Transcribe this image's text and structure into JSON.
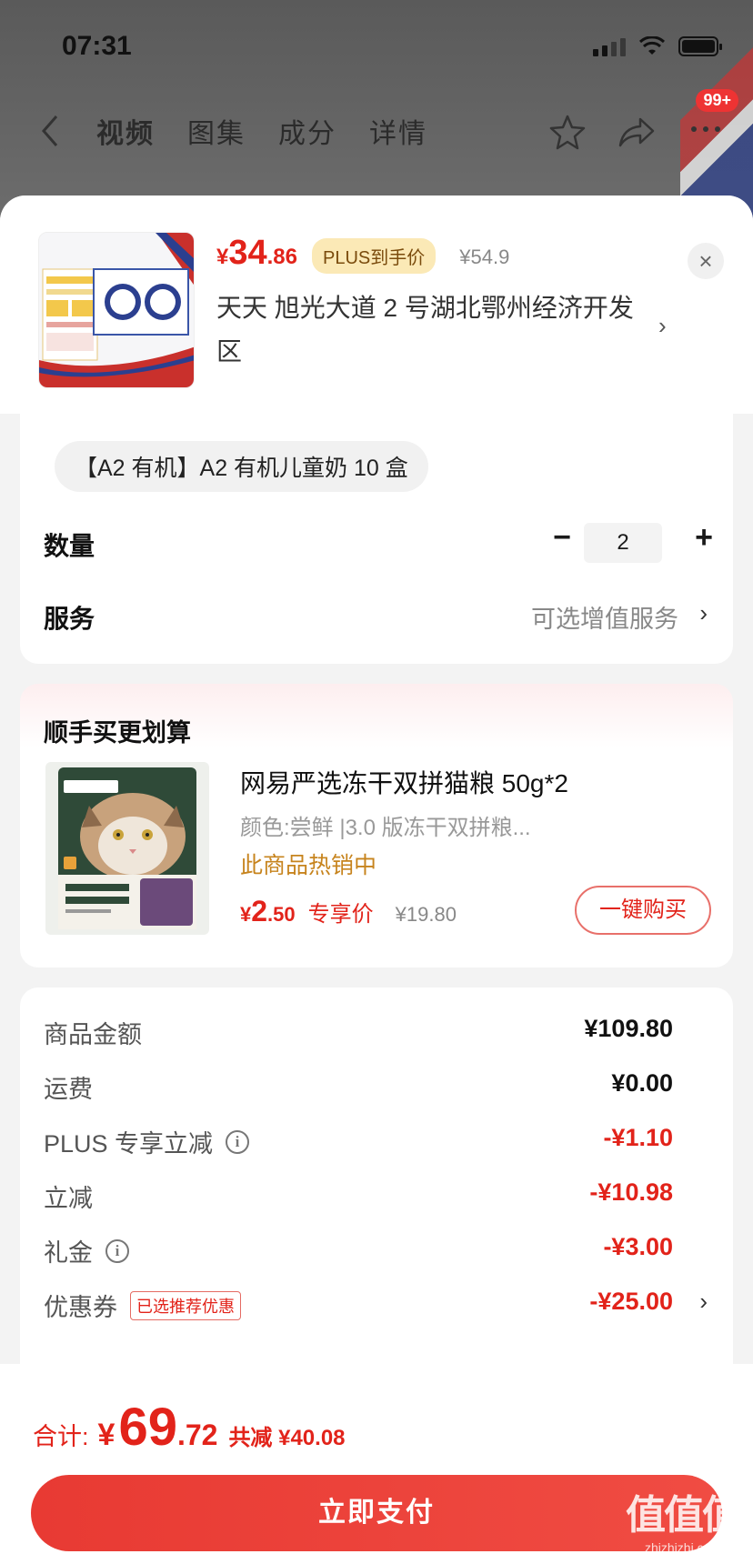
{
  "status_bar": {
    "time": "07:31"
  },
  "nav": {
    "tabs": [
      "视频",
      "图集",
      "成分",
      "详情"
    ],
    "badge": "99+"
  },
  "product": {
    "price_yen": "¥",
    "price_int": "34",
    "price_dec": ".86",
    "plus_tag": "PLUS到手价",
    "original_price": "¥54.9",
    "address": "天天  旭光大道 2 号湖北鄂州经济开发区",
    "arrow": "›",
    "close": "×"
  },
  "spec": {
    "chip": "【A2 有机】A2 有机儿童奶 10 盒",
    "quantity_label": "数量",
    "quantity_value": "2",
    "minus": "−",
    "plus": "+",
    "service_label": "服务",
    "service_value": "可选增值服务",
    "service_arrow": "›"
  },
  "upsell": {
    "title": "顺手买更划算",
    "name": "网易严选冻干双拼猫粮 50g*2",
    "spec": "颜色:尝鲜 |3.0 版冻干双拼粮...",
    "hot": "此商品热销中",
    "price_yen": "¥",
    "price_int": "2",
    "price_dec": ".50",
    "exclusive": "专享价",
    "original_price": "¥19.80",
    "buy_button": "一键购买"
  },
  "summary": {
    "rows": [
      {
        "label": "商品金额",
        "value": "¥109.80"
      },
      {
        "label": "运费",
        "value": "¥0.00"
      },
      {
        "label": "PLUS 专享立减",
        "value": "-¥1.10"
      },
      {
        "label": "立减",
        "value": "-¥10.98"
      },
      {
        "label": "礼金",
        "value": "-¥3.00"
      },
      {
        "label": "优惠券",
        "value": "-¥25.00",
        "tag": "已选推荐优惠"
      }
    ],
    "arrow": "›",
    "info": "i"
  },
  "footer": {
    "total_label": "合计:",
    "total_yen": "¥",
    "total_int": "69",
    "total_dec": ".72",
    "save_text": "共减 ¥40.08",
    "pay_button": "立即支付"
  },
  "watermark": {
    "main": "值值值",
    "sub": "zhizhizhi.com"
  },
  "colors": {
    "accent": "#e2231a",
    "plus_tag_bg": "#fbe9b6",
    "hot": "#c7841e"
  }
}
